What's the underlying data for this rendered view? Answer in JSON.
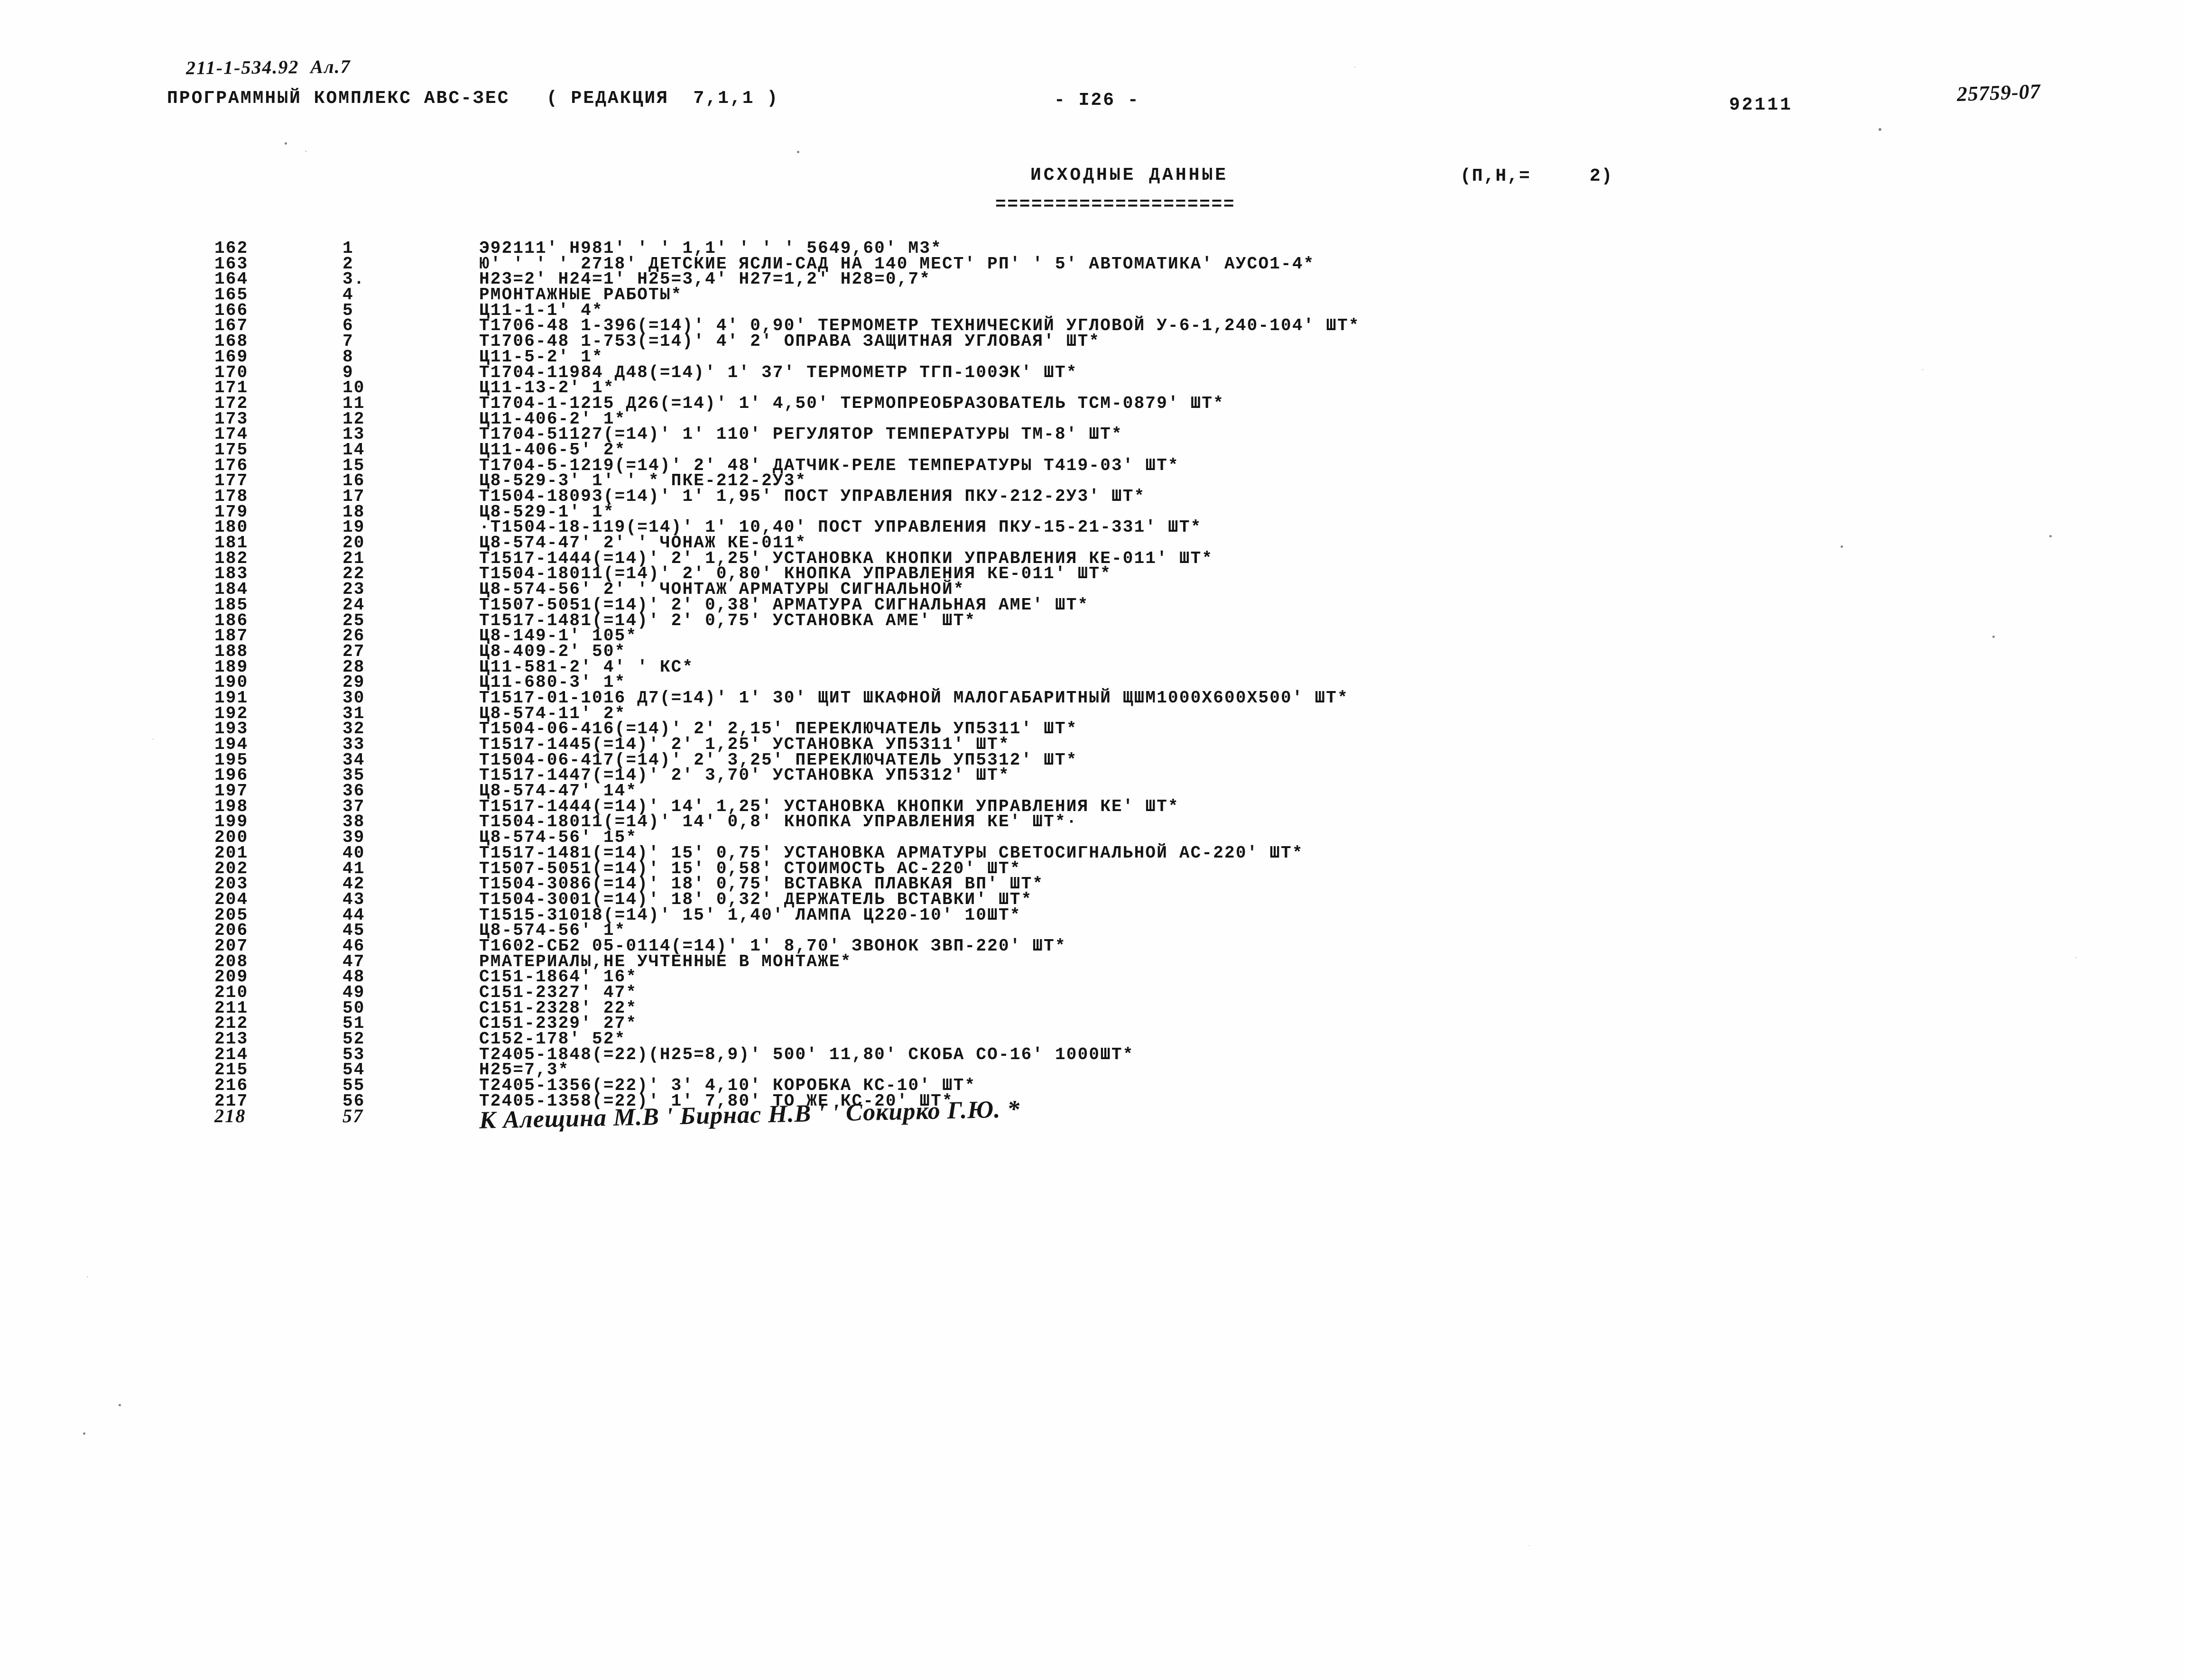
{
  "header": {
    "doc_code": "211-1-534.92  Ал.7",
    "program_line": "ПРОГРАММНЫЙ КОМПЛЕКС АВС-ЗЕС   ( РЕДАКЦИЯ  7,1,1 )",
    "page_marker": "- I26 -",
    "right_code": "92111",
    "handwritten_code": "25759-07"
  },
  "title": {
    "main": "ИСХОДНЫЕ ДАННЫЕ",
    "param": "(П,Н,=     2)",
    "rule": "===================="
  },
  "listing": {
    "rows": [
      {
        "seq": "162",
        "idx": "1",
        "text": "Э92111' Н981' ' ' 1,1' ' ' ' 5649,60' М3*"
      },
      {
        "seq": "163",
        "idx": "2",
        "text": "Ю' ' ' ' 2718' ДЕТСКИЕ ЯСЛИ-САД НА 140 МЕСТ' РП' ' 5' АВТОМАТИКА' АУСО1-4*"
      },
      {
        "seq": "164",
        "idx": "3.",
        "text": "Н23=2' Н24=1' Н25=3,4' Н27=1,2' Н28=0,7*"
      },
      {
        "seq": "165",
        "idx": "4",
        "text": "РМОНТАЖНЫЕ РАБОТЫ*"
      },
      {
        "seq": "166",
        "idx": "5",
        "text": "Ц11-1-1' 4*"
      },
      {
        "seq": "167",
        "idx": "6",
        "text": "Т1706-48 1-396(=14)' 4' 0,90' ТЕРМОМЕТР ТЕХНИЧЕСКИЙ УГЛОВОЙ У-6-1,240-104' ШТ*"
      },
      {
        "seq": "168",
        "idx": "7",
        "text": "Т1706-48 1-753(=14)' 4' 2' ОПРАВА ЗАЩИТНАЯ УГЛОВАЯ' ШТ*"
      },
      {
        "seq": "169",
        "idx": "8",
        "text": "Ц11-5-2' 1*"
      },
      {
        "seq": "170",
        "idx": "9",
        "text": "Т1704-11984 Д48(=14)' 1' 37' ТЕРМОМЕТР ТГП-100ЭК' ШТ*"
      },
      {
        "seq": "171",
        "idx": "10",
        "text": "Ц11-13-2' 1*"
      },
      {
        "seq": "172",
        "idx": "11",
        "text": "Т1704-1-1215 Д26(=14)' 1' 4,50' ТЕРМОПРЕОБРАЗОВАТЕЛЬ ТСМ-0879' ШТ*"
      },
      {
        "seq": "173",
        "idx": "12",
        "text": "Ц11-406-2' 1*"
      },
      {
        "seq": "174",
        "idx": "13",
        "text": "Т1704-51127(=14)' 1' 110' РЕГУЛЯТОР ТЕМПЕРАТУРЫ ТМ-8' ШТ*"
      },
      {
        "seq": "175",
        "idx": "14",
        "text": "Ц11-406-5' 2*"
      },
      {
        "seq": "176",
        "idx": "15",
        "text": "Т1704-5-1219(=14)' 2' 48' ДАТЧИК-РЕЛЕ ТЕМПЕРАТУРЫ Т419-03' ШТ*"
      },
      {
        "seq": "177",
        "idx": "16",
        "text": "Ц8-529-3' 1' ' * ПКЕ-212-2У3*"
      },
      {
        "seq": "178",
        "idx": "17",
        "text": "Т1504-18093(=14)' 1' 1,95' ПОСТ УПРАВЛЕНИЯ ПКУ-212-2У3' ШТ*"
      },
      {
        "seq": "179",
        "idx": "18",
        "text": "Ц8-529-1' 1*"
      },
      {
        "seq": "180",
        "idx": "19",
        "text": "·Т1504-18-119(=14)' 1' 10,40' ПОСТ УПРАВЛЕНИЯ ПКУ-15-21-331' ШТ*"
      },
      {
        "seq": "181",
        "idx": "20",
        "text": "Ц8-574-47' 2' ' ЧОНАЖ КЕ-011*"
      },
      {
        "seq": "182",
        "idx": "21",
        "text": "Т1517-1444(=14)' 2' 1,25' УСТАНОВКА КНОПКИ УПРАВЛЕНИЯ КЕ-011' ШТ*"
      },
      {
        "seq": "183",
        "idx": "22",
        "text": "Т1504-18011(=14)' 2' 0,80' КНОПКА УПРАВЛЕНИЯ КЕ-011' ШТ*"
      },
      {
        "seq": "184",
        "idx": "23",
        "text": "Ц8-574-56' 2' ' ЧОНТАЖ АРМАТУРЫ СИГНАЛЬНОЙ*"
      },
      {
        "seq": "185",
        "idx": "24",
        "text": "Т1507-5051(=14)' 2' 0,38' АРМАТУРА СИГНАЛЬНАЯ АМЕ' ШТ*"
      },
      {
        "seq": "186",
        "idx": "25",
        "text": "Т1517-1481(=14)' 2' 0,75' УСТАНОВКА АМЕ' ШТ*"
      },
      {
        "seq": "187",
        "idx": "26",
        "text": "Ц8-149-1' 105*"
      },
      {
        "seq": "188",
        "idx": "27",
        "text": "Ц8-409-2' 50*"
      },
      {
        "seq": "189",
        "idx": "28",
        "text": "Ц11-581-2' 4' ' КС*"
      },
      {
        "seq": "190",
        "idx": "29",
        "text": "Ц11-680-3' 1*"
      },
      {
        "seq": "191",
        "idx": "30",
        "text": "Т1517-01-1016 Д7(=14)' 1' 30' ЩИТ ШКАФНОЙ МАЛОГАБАРИТНЫЙ ЩШМ1000Х600Х500' ШТ*"
      },
      {
        "seq": "192",
        "idx": "31",
        "text": "Ц8-574-11' 2*"
      },
      {
        "seq": "193",
        "idx": "32",
        "text": "Т1504-06-416(=14)' 2' 2,15' ПЕРЕКЛЮЧАТЕЛЬ УП5311' ШТ*"
      },
      {
        "seq": "194",
        "idx": "33",
        "text": "Т1517-1445(=14)' 2' 1,25' УСТАНОВКА УП5311' ШТ*"
      },
      {
        "seq": "195",
        "idx": "34",
        "text": "Т1504-06-417(=14)' 2' 3,25' ПЕРЕКЛЮЧАТЕЛЬ УП5312' ШТ*"
      },
      {
        "seq": "196",
        "idx": "35",
        "text": "Т1517-1447(=14)' 2' 3,70' УСТАНОВКА УП5312' ШТ*"
      },
      {
        "seq": "197",
        "idx": "36",
        "text": "Ц8-574-47' 14*"
      },
      {
        "seq": "198",
        "idx": "37",
        "text": "Т1517-1444(=14)' 14' 1,25' УСТАНОВКА КНОПКИ УПРАВЛЕНИЯ КЕ' ШТ*"
      },
      {
        "seq": "199",
        "idx": "38",
        "text": "Т1504-18011(=14)' 14' 0,8' КНОПКА УПРАВЛЕНИЯ КЕ' ШТ*·"
      },
      {
        "seq": "200",
        "idx": "39",
        "text": "Ц8-574-56' 15*"
      },
      {
        "seq": "201",
        "idx": "40",
        "text": "Т1517-1481(=14)' 15' 0,75' УСТАНОВКА АРМАТУРЫ СВЕТОСИГНАЛЬНОЙ АС-220' ШТ*"
      },
      {
        "seq": "202",
        "idx": "41",
        "text": "Т1507-5051(=14)' 15' 0,58' СТОИМОСТЬ АС-220' ШТ*"
      },
      {
        "seq": "203",
        "idx": "42",
        "text": "Т1504-3086(=14)' 18' 0,75' ВСТАВКА ПЛАВКАЯ ВП' ШТ*"
      },
      {
        "seq": "204",
        "idx": "43",
        "text": "Т1504-3001(=14)' 18' 0,32' ДЕРЖАТЕЛЬ ВСТАВКИ' ШТ*"
      },
      {
        "seq": "205",
        "idx": "44",
        "text": "Т1515-31018(=14)' 15' 1,40' ЛАМПА Ц220-10' 10ШТ*"
      },
      {
        "seq": "206",
        "idx": "45",
        "text": "Ц8-574-56' 1*"
      },
      {
        "seq": "207",
        "idx": "46",
        "text": "Т1602-СБ2 05-0114(=14)' 1' 8,70' ЗВОНОК ЗВП-220' ШТ*"
      },
      {
        "seq": "208",
        "idx": "47",
        "text": "РМАТЕРИАЛЫ,НЕ УЧТЕННЫЕ В МОНТАЖЕ*"
      },
      {
        "seq": "209",
        "idx": "48",
        "text": "С151-1864' 16*"
      },
      {
        "seq": "210",
        "idx": "49",
        "text": "С151-2327' 47*"
      },
      {
        "seq": "211",
        "idx": "50",
        "text": "С151-2328' 22*"
      },
      {
        "seq": "212",
        "idx": "51",
        "text": "С151-2329' 27*"
      },
      {
        "seq": "213",
        "idx": "52",
        "text": "С152-178' 52*"
      },
      {
        "seq": "214",
        "idx": "53",
        "text": "Т2405-1848(=22)(Н25=8,9)' 500' 11,80' СКОБА СО-16' 1000ШТ*"
      },
      {
        "seq": "215",
        "idx": "54",
        "text": "Н25=7,3*"
      },
      {
        "seq": "216",
        "idx": "55",
        "text": "Т2405-1356(=22)' 3' 4,10' КОРОБКА КС-10' ШТ*"
      },
      {
        "seq": "217",
        "idx": "56",
        "text": "Т2405-1358(=22)' 1' 7,80' ТО ЖЕ КС-20' ШТ*"
      },
      {
        "seq": "218",
        "idx": "57",
        "text": "К Алещина М.В ' Бирнас Н.В ' ' Сокирко Г.Ю. *",
        "handwritten": true
      }
    ]
  }
}
